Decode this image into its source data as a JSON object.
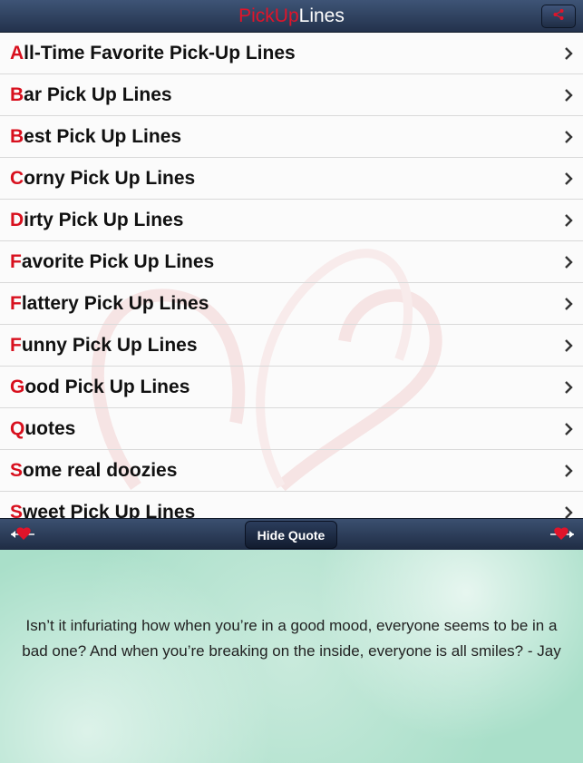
{
  "header": {
    "title_part1": "PickUp",
    "title_part2": "Lines",
    "share_icon": "share-icon"
  },
  "list": {
    "items": [
      {
        "first": "A",
        "rest": "ll-Time Favorite Pick-Up Lines"
      },
      {
        "first": "B",
        "rest": "ar Pick Up Lines"
      },
      {
        "first": "B",
        "rest": "est Pick Up Lines"
      },
      {
        "first": "C",
        "rest": "orny Pick Up Lines"
      },
      {
        "first": "D",
        "rest": "irty Pick Up Lines"
      },
      {
        "first": "F",
        "rest": "avorite Pick Up Lines"
      },
      {
        "first": "F",
        "rest": "lattery Pick Up Lines"
      },
      {
        "first": "F",
        "rest": "unny Pick Up Lines"
      },
      {
        "first": "G",
        "rest": "ood Pick Up Lines"
      },
      {
        "first": "Q",
        "rest": "uotes"
      },
      {
        "first": "S",
        "rest": "ome real doozies"
      },
      {
        "first": "S",
        "rest": "weet Pick Up Lines"
      }
    ]
  },
  "toolbar": {
    "hide_quote_label": "Hide Quote"
  },
  "quote": {
    "text": "Isn’t it infuriating how when you’re in a good mood, everyone seems to be in a bad one? And when you’re breaking on the inside, everyone is all smiles? - Jay"
  },
  "colors": {
    "accent_red": "#d8101e",
    "bar_dark": "#23324c"
  }
}
